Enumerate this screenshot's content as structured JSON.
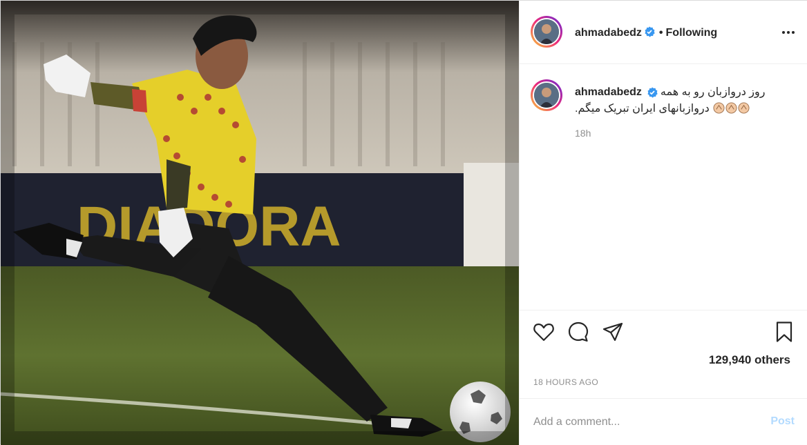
{
  "post": {
    "username": "ahmadabedz",
    "follow_status": "Following",
    "separator": "•",
    "caption_line1": "روز دروازبان رو به همه",
    "caption_line2": "دروازبانهای ایران تبریک میگم.",
    "caption_emoji": "clapping-hands",
    "caption_time": "18h",
    "likes_text": "129,940 others",
    "posted_ago": "18 HOURS AGO",
    "comment_placeholder": "Add a comment...",
    "post_button": "Post"
  },
  "photo": {
    "sponsor_banner": "DIADORA",
    "subject": "goalkeeper kicking ball"
  },
  "icons": {
    "like": "heart-icon",
    "comment": "comment-icon",
    "share": "share-icon",
    "save": "bookmark-icon",
    "more": "more-options-icon",
    "verified": "verified-badge-icon"
  },
  "colors": {
    "verified": "#3897f0",
    "post_button_disabled": "#b3dbff",
    "secondary_text": "#8e8e8e",
    "jersey": "#e8d32a"
  }
}
